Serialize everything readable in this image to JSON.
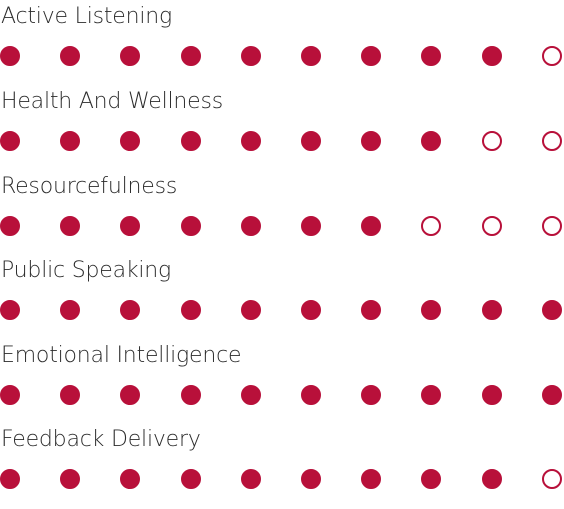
{
  "accent_color": "#b8103a",
  "max_rating": 10,
  "skills": [
    {
      "label": "Active Listening",
      "rating": 9
    },
    {
      "label": "Health And Wellness",
      "rating": 8
    },
    {
      "label": "Resourcefulness",
      "rating": 7
    },
    {
      "label": "Public Speaking",
      "rating": 10
    },
    {
      "label": "Emotional Intelligence",
      "rating": 10
    },
    {
      "label": "Feedback Delivery",
      "rating": 9
    }
  ]
}
